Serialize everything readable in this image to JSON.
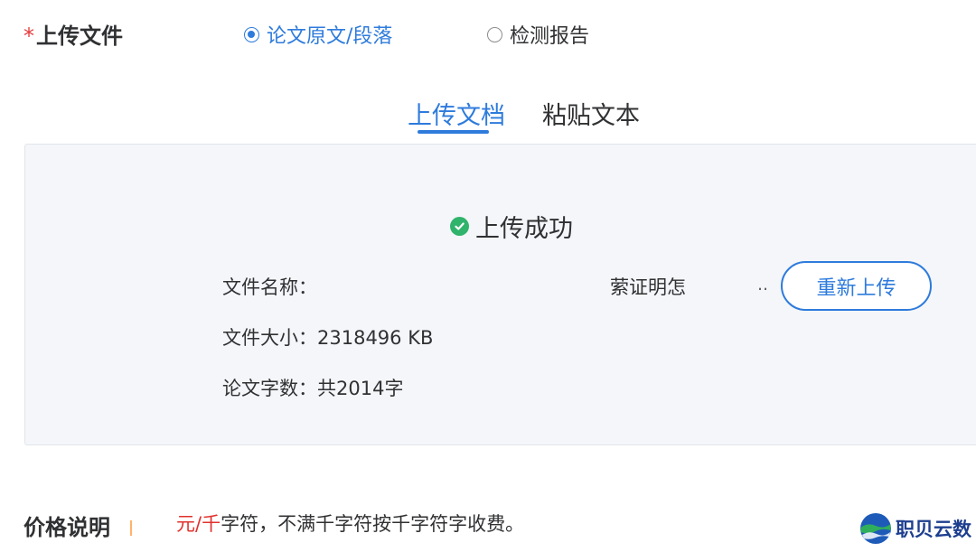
{
  "upload": {
    "required_mark": "*",
    "label": "上传文件",
    "options": [
      "论文原文/段落",
      "检测报告"
    ],
    "selected_option": "论文原文/段落"
  },
  "tabs": {
    "upload_doc": "上传文档",
    "paste_text": "粘贴文本",
    "active": "上传文档"
  },
  "status": {
    "text": "上传成功"
  },
  "file": {
    "name_label": "文件名称：",
    "name_value": "萦证明怎",
    "name_ellipsis": "..",
    "size_label": "文件大小：",
    "size_value": "2318496 KB",
    "words_label": "论文字数：",
    "words_value": "共2014字"
  },
  "actions": {
    "reupload": "重新上传"
  },
  "price": {
    "label": "价格说明",
    "unit": "元/千",
    "text": "字符，不满千字符按千字符字收费。"
  },
  "watermark": {
    "text": "职贝云数"
  },
  "colors": {
    "accent": "#2e7bdc",
    "success": "#30b36b",
    "required": "#e63b3b",
    "price_highlight": "#e0322d",
    "panel_bg": "#f4f6f9"
  }
}
